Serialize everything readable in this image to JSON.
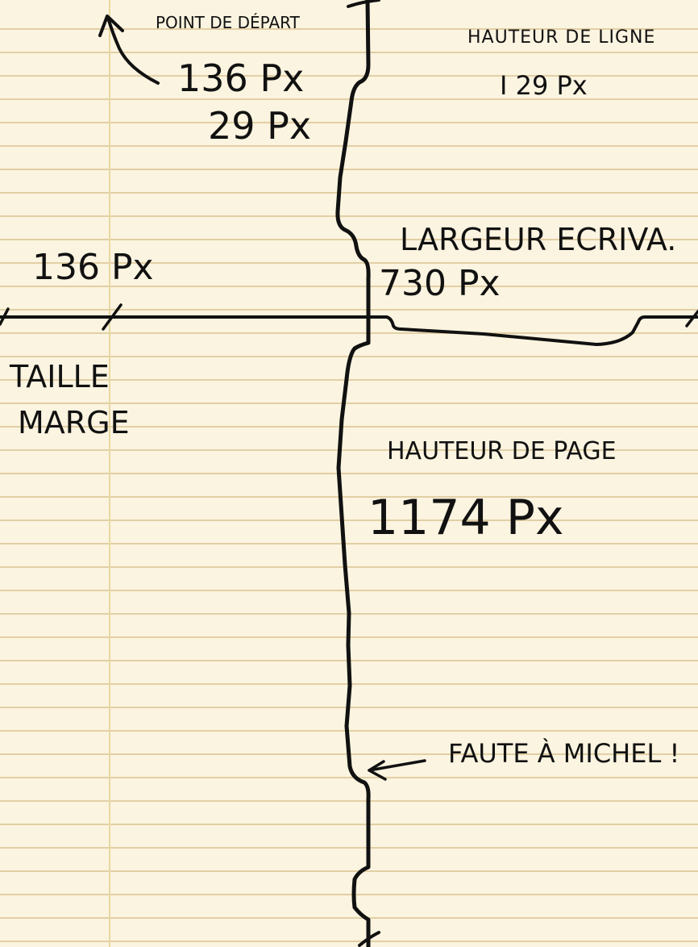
{
  "notes": {
    "start_label": "POINT DE DÉPART",
    "start_x": "136 Px",
    "start_y": "29 Px",
    "line_height_label": "HAUTEUR DE LIGNE",
    "line_height_value": "I 29 Px",
    "width_label": "LARGEUR ECRIVA.",
    "width_value": "730 Px",
    "margin_value": "136 Px",
    "margin_label_line1": "TAILLE",
    "margin_label_line2": "MARGE",
    "page_height_label": "HAUTEUR DE PAGE",
    "page_height_value": "1174 Px",
    "annotation": "FAUTE À MICHEL !"
  },
  "colors": {
    "paper": "#fbf4e0",
    "rule_lines": "#e2cfa5",
    "margin_line": "#e7d9a2",
    "ink": "#111111"
  },
  "icons": {
    "start_arrow": "curved-arrow-up-left-icon",
    "annotation_arrow": "arrow-left-icon"
  }
}
